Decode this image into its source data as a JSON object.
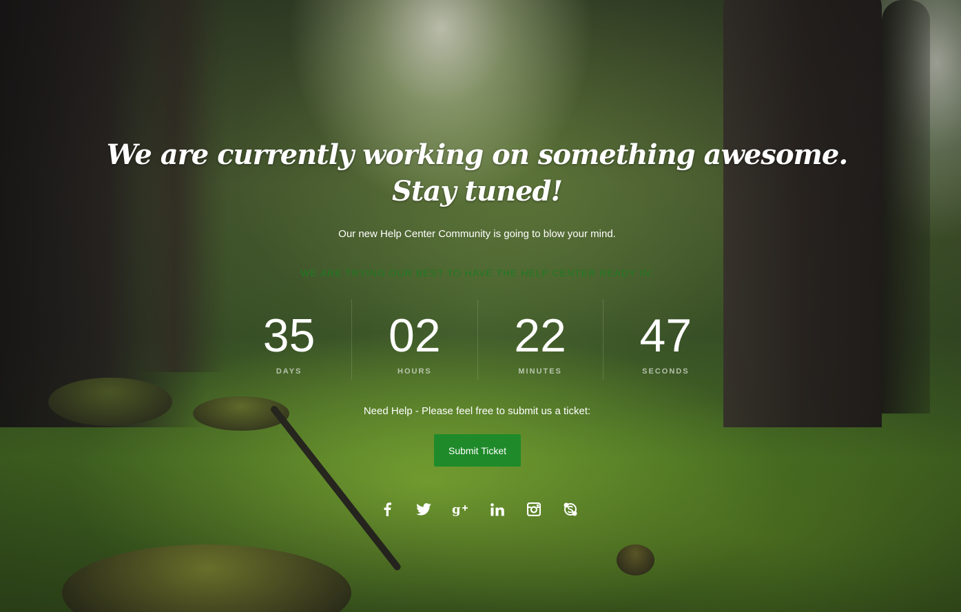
{
  "headline": {
    "line1": "We are currently working on something awesome.",
    "line2": "Stay tuned!"
  },
  "subtext": "Our new Help Center Community is going to blow your mind.",
  "ready_text": "WE ARE TRYING OUR BEST TO HAVE THE HELP CENTER READY IN:",
  "countdown": {
    "days": {
      "value": "35",
      "label": "DAYS"
    },
    "hours": {
      "value": "02",
      "label": "HOURS"
    },
    "minutes": {
      "value": "22",
      "label": "MINUTES"
    },
    "seconds": {
      "value": "47",
      "label": "SECONDS"
    }
  },
  "help_text": "Need Help - Please feel free to submit us a ticket:",
  "submit_button": "Submit Ticket",
  "social": [
    {
      "icon": "facebook-icon"
    },
    {
      "icon": "twitter-icon"
    },
    {
      "icon": "google-plus-icon"
    },
    {
      "icon": "linkedin-icon"
    },
    {
      "icon": "instagram-icon"
    },
    {
      "icon": "skype-icon"
    }
  ],
  "colors": {
    "button": "#1f8a2a",
    "ready_text": "#1e7a22",
    "text": "#ffffff"
  }
}
